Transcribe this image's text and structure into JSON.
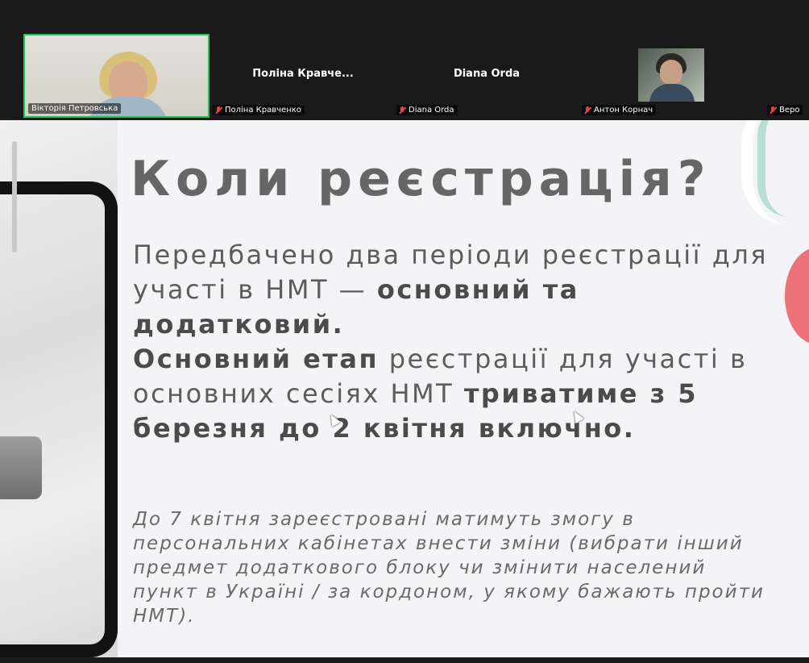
{
  "participants": {
    "active": {
      "name": "Вікторія Петровська"
    },
    "p2": {
      "display": "Поліна  Кравче...",
      "tag": "Поліна Кравченко"
    },
    "p3": {
      "display": "Diana Orda",
      "tag": "Diana Orda"
    },
    "p4": {
      "tag": "Антон Корнач"
    },
    "p5": {
      "tag": "Веро"
    }
  },
  "slide": {
    "title": "Коли реєстрація?",
    "p1_a": "Передбачено два періоди реєстрації для участі в НМТ — ",
    "p1_b": "основний та додатковий.",
    "p2_a": "Основний етап",
    "p2_b": " реєстрації для участі в основних сесіях НМТ ",
    "p2_c": "триватиме з 5 березня до 2 квітня включно.",
    "note": "До 7 квітня зареєстровані матимуть змогу в персональних кабінетах внести зміни (вибрати інший предмет додаткового блоку чи змінити населений пункт в Україні / за кордоном, у якому бажають пройти НМТ)."
  },
  "icons": {
    "mic": "mic-muted-icon",
    "cursor": "mouse-pointer-icon"
  },
  "colors": {
    "active_border": "#25c35a",
    "muted_mic": "#e04646",
    "accent_circle": "#ee707a"
  }
}
